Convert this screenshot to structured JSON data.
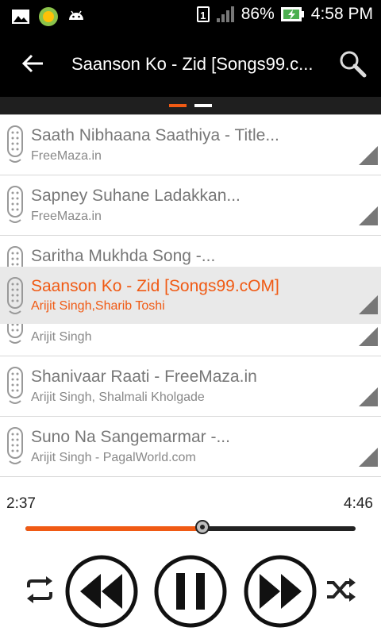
{
  "status": {
    "battery": "86%",
    "time": "4:58 PM",
    "sim_slot": "1"
  },
  "header": {
    "title": "Saanson Ko - Zid [Songs99.c..."
  },
  "songs": [
    {
      "title": "Saath Nibhaana Saathiya - Title...",
      "artist": "FreeMaza.in"
    },
    {
      "title": "Sapney Suhane Ladakkan...",
      "artist": "FreeMaza.in"
    },
    {
      "title": "Saritha Mukhda Song -...",
      "artist": ""
    },
    {
      "title": "",
      "artist": "Arijit Singh"
    },
    {
      "title": "Shanivaar Raati - FreeMaza.in",
      "artist": "Arijit Singh, Shalmali Kholgade"
    },
    {
      "title": "Suno Na Sangemarmar -...",
      "artist": "Arijit Singh - PagalWorld.com"
    }
  ],
  "now_playing": {
    "title": "Saanson Ko - Zid [Songs99.cOM]",
    "artist": "Arijit Singh,Sharib Toshi"
  },
  "player": {
    "current_time": "2:37",
    "total_time": "4:46",
    "progress": 0.537
  },
  "colors": {
    "accent": "#f05a14",
    "bar": "#000000"
  }
}
